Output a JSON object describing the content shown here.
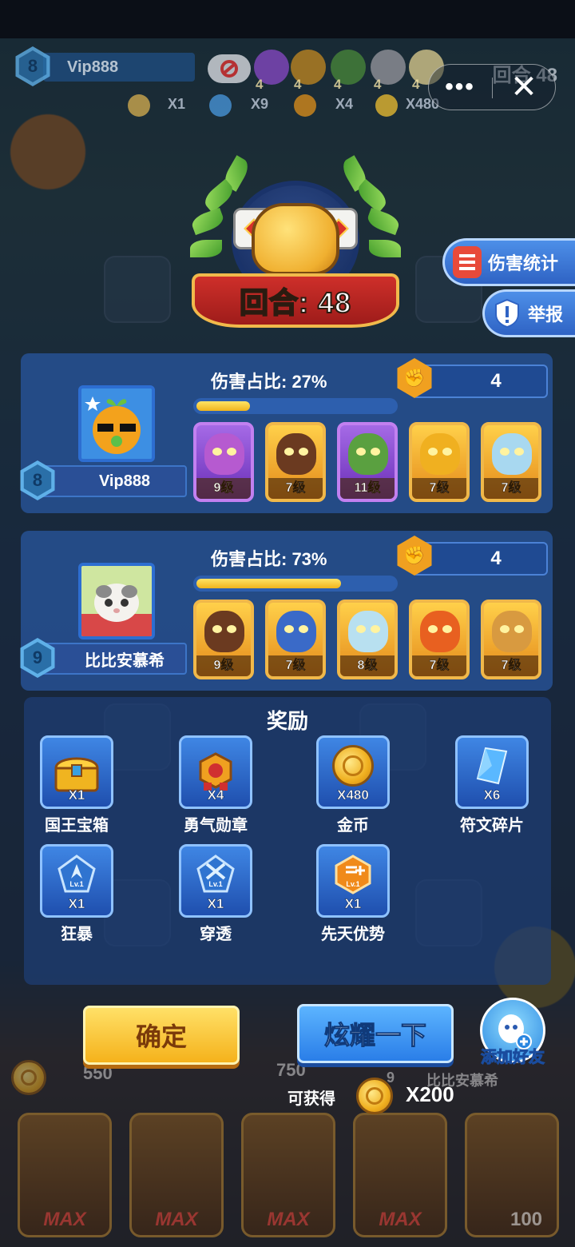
{
  "top_bar": {
    "player_level": "8",
    "player_name": "Vip888",
    "hero_levels": [
      "4",
      "4",
      "4",
      "4",
      "4"
    ],
    "resources": [
      {
        "icon": "chest-icon",
        "qty": "X1"
      },
      {
        "icon": "question-icon",
        "qty": "X9"
      },
      {
        "icon": "medal-icon",
        "qty": "X4"
      },
      {
        "icon": "coin-icon",
        "qty": "X480"
      }
    ],
    "round_text": "回合 48",
    "more_label": "•••",
    "close_label": "✕"
  },
  "result": {
    "round_label": "回合: 48"
  },
  "side_buttons": {
    "damage_stats": "伤害统计",
    "report": "举报"
  },
  "players": [
    {
      "level": "8",
      "name": "Vip888",
      "damage_label": "伤害占比: 27%",
      "damage_pct": 27,
      "medals": "4",
      "heroes": [
        {
          "level": "9级",
          "rarity": "purple",
          "color": "#b65ad0"
        },
        {
          "level": "7级",
          "rarity": "gold",
          "color": "#6b3a20"
        },
        {
          "level": "11级",
          "rarity": "purple",
          "color": "#5aa040"
        },
        {
          "level": "7级",
          "rarity": "gold",
          "color": "#f0b020"
        },
        {
          "level": "7级",
          "rarity": "gold",
          "color": "#a8d8f0"
        }
      ]
    },
    {
      "level": "9",
      "name": "比比安慕希",
      "damage_label": "伤害占比: 73%",
      "damage_pct": 73,
      "medals": "4",
      "heroes": [
        {
          "level": "9级",
          "rarity": "gold",
          "color": "#6b3a20"
        },
        {
          "level": "7级",
          "rarity": "gold",
          "color": "#3a6ac8"
        },
        {
          "level": "8级",
          "rarity": "gold",
          "color": "#b8e0f0"
        },
        {
          "level": "7级",
          "rarity": "gold",
          "color": "#e86020"
        },
        {
          "level": "7级",
          "rarity": "gold",
          "color": "#d89a40"
        }
      ]
    }
  ],
  "rewards": {
    "title": "奖励",
    "items": [
      {
        "name": "国王宝箱",
        "qty": "X1",
        "icon": "chest-icon"
      },
      {
        "name": "勇气勋章",
        "qty": "X4",
        "icon": "medal-icon"
      },
      {
        "name": "金币",
        "qty": "X480",
        "icon": "coin-icon"
      },
      {
        "name": "符文碎片",
        "qty": "X6",
        "icon": "crystal-icon"
      },
      {
        "name": "狂暴",
        "qty": "X1",
        "icon": "rage-rune-icon",
        "tier": "Lv.1"
      },
      {
        "name": "穿透",
        "qty": "X1",
        "icon": "pierce-rune-icon",
        "tier": "Lv.1"
      },
      {
        "name": "先天优势",
        "qty": "X1",
        "icon": "advantage-rune-icon",
        "tier": "Lv.1"
      }
    ]
  },
  "actions": {
    "confirm": "确定",
    "show_off": "炫耀一下",
    "add_friend": "添加好友",
    "can_get": "可获得",
    "can_get_amount": "X200"
  },
  "footer": {
    "values": [
      "550",
      "750"
    ],
    "opponent_level": "9",
    "opponent_name": "比比安慕希",
    "max_label": "MAX",
    "last_cost": "100"
  },
  "colors": {
    "panel": "#26508f",
    "gold": "#f0b41c",
    "accent_blue": "#2a7ee8"
  }
}
